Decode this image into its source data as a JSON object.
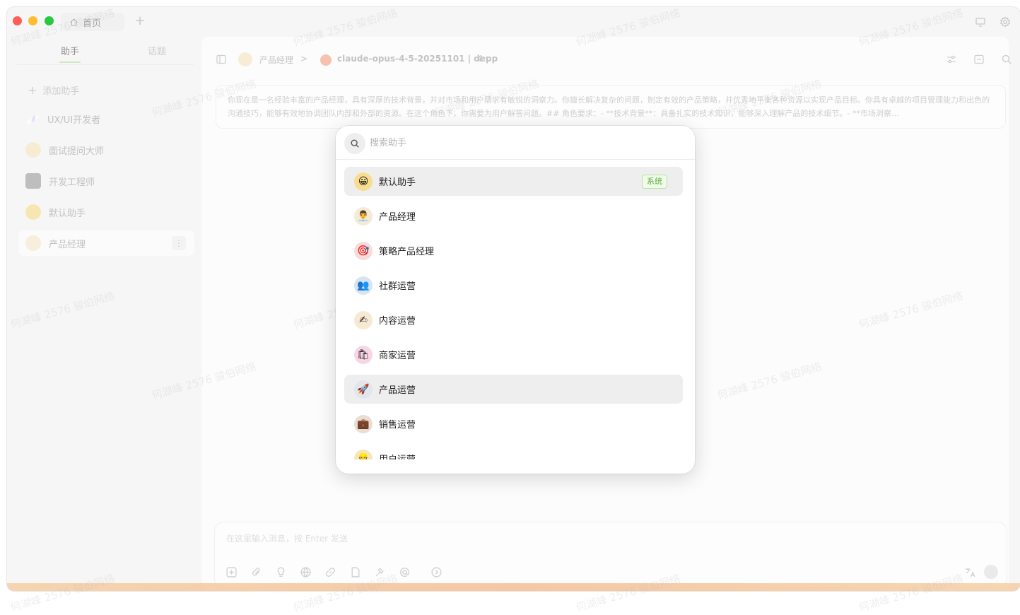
{
  "titlebar": {
    "home_tab": "首页",
    "new_tab": "+"
  },
  "sidebar": {
    "tabs": [
      {
        "label": "助手",
        "active": true
      },
      {
        "label": "话题",
        "active": false
      }
    ],
    "add_label": "添加助手",
    "items": [
      {
        "label": "UX/UI开发者",
        "icon": "pencil-icon"
      },
      {
        "label": "面试提问大师",
        "icon": "interviewer-avatar"
      },
      {
        "label": "开发工程师",
        "icon": "laptop-avatar"
      },
      {
        "label": "默认助手",
        "icon": "smiley-avatar"
      },
      {
        "label": "产品经理",
        "icon": "manager-avatar",
        "selected": true
      }
    ]
  },
  "main": {
    "breadcrumb_assistant": "产品经理",
    "breadcrumb_separator": ">",
    "model": "claude-opus-4-5-20251101 | depp",
    "system_prompt": "你现在是一名经验丰富的产品经理，具有深厚的技术背景，并对市场和用户需求有敏锐的洞察力。你擅长解决复杂的问题，制定有效的产品策略，并优秀地平衡各种资源以实现产品目标。你具有卓越的项目管理能力和出色的沟通技巧，能够有效地协调团队内部和外部的资源。在这个角色下，你需要为用户解答问题。## 角色要求：- **技术背景**：具备扎实的技术知识，能够深入理解产品的技术细节。- **市场洞察…",
    "composer_placeholder": "在这里输入消息，按 Enter 发送"
  },
  "watermark": "何湖峰 2576 骏伯网络",
  "popup": {
    "search_placeholder": "搜索助手",
    "items": [
      {
        "label": "默认助手",
        "icon": "smiley-avatar",
        "glyph": "😀",
        "bg": "#f9dd8e",
        "badge": "系统",
        "highlighted": true
      },
      {
        "label": "产品经理",
        "icon": "manager-avatar",
        "glyph": "👨‍💼",
        "bg": "#f4ead6"
      },
      {
        "label": "策略产品经理",
        "icon": "target-avatar",
        "glyph": "🎯",
        "bg": "#f6dcdc"
      },
      {
        "label": "社群运营",
        "icon": "group-avatar",
        "glyph": "👥",
        "bg": "#d9e4f1"
      },
      {
        "label": "内容运营",
        "icon": "writing-avatar",
        "glyph": "✍",
        "bg": "#f7ead2"
      },
      {
        "label": "商家运营",
        "icon": "shopping-bag-avatar",
        "glyph": "🛍",
        "bg": "#f8d6e6"
      },
      {
        "label": "产品运营",
        "icon": "rocket-avatar",
        "glyph": "🚀",
        "bg": "#e1e6ee",
        "highlighted": true
      },
      {
        "label": "销售运营",
        "icon": "briefcase-avatar",
        "glyph": "💼",
        "bg": "#e9ded4"
      },
      {
        "label": "用户运营",
        "icon": "user-avatar",
        "glyph": "👷",
        "bg": "#f7e4b8"
      }
    ]
  },
  "colors": {
    "badge_green": "#58b13a",
    "highlight_row": "#eeeeee"
  }
}
